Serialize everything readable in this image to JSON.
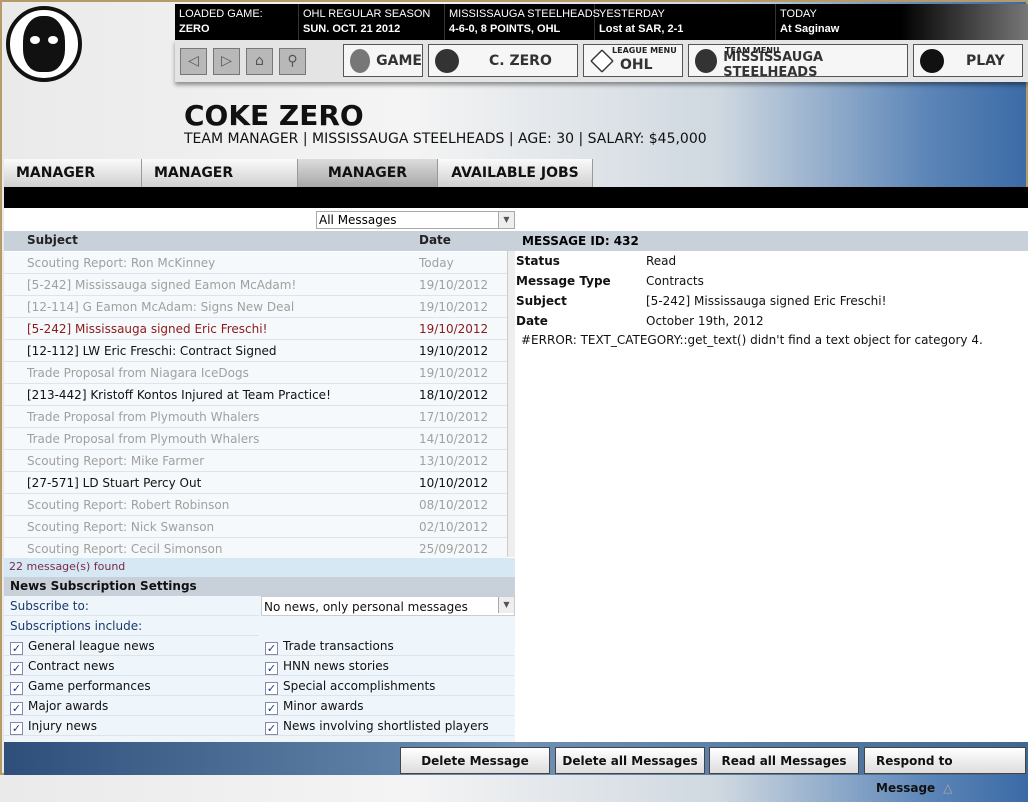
{
  "top": {
    "cells": [
      {
        "l1": "LOADED GAME:",
        "l2": "ZERO"
      },
      {
        "l1": "OHL REGULAR SEASON",
        "l2": "SUN. OCT. 21 2012"
      },
      {
        "l1": "MISSISSAUGA STEELHEADS",
        "l2": "4-6-0, 8 POINTS, OHL"
      },
      {
        "l1": "YESTERDAY",
        "l2": "Lost at SAR, 2-1"
      },
      {
        "l1": "TODAY",
        "l2": "At Saginaw"
      }
    ]
  },
  "nav": {
    "game": "GAME",
    "manager": "C. ZERO",
    "league_small": "LEAGUE MENU",
    "league": "OHL",
    "team_small": "TEAM MENU",
    "team": "MISSISSAUGA STEELHEADS",
    "play": "PLAY"
  },
  "header": {
    "name": "COKE ZERO",
    "subtitle": "TEAM MANAGER | MISSISSAUGA STEELHEADS |  AGE: 30 | SALARY: $45,000"
  },
  "tabs": [
    "MANAGER HOME",
    "MANAGER OPTIONS",
    "MANAGER NEWS",
    "AVAILABLE JOBS"
  ],
  "filter": "All Messages",
  "list": {
    "col_subject": "Subject",
    "col_date": "Date",
    "rows": [
      {
        "subject": "Scouting Report: Ron McKinney",
        "date": "Today",
        "state": "read"
      },
      {
        "subject": "[5-242] Mississauga signed Eamon McAdam!",
        "date": "19/10/2012",
        "state": "read"
      },
      {
        "subject": "[12-114] G Eamon McAdam: Signs New Deal",
        "date": "19/10/2012",
        "state": "read"
      },
      {
        "subject": "[5-242] Mississauga signed Eric Freschi!",
        "date": "19/10/2012",
        "state": "selected"
      },
      {
        "subject": "[12-112] LW Eric Freschi: Contract Signed",
        "date": "19/10/2012",
        "state": "unread"
      },
      {
        "subject": "Trade Proposal from Niagara IceDogs",
        "date": "19/10/2012",
        "state": "read"
      },
      {
        "subject": "[213-442] Kristoff Kontos Injured at Team Practice!",
        "date": "18/10/2012",
        "state": "unread"
      },
      {
        "subject": "Trade Proposal from Plymouth Whalers",
        "date": "17/10/2012",
        "state": "read"
      },
      {
        "subject": "Trade Proposal from Plymouth Whalers",
        "date": "14/10/2012",
        "state": "read"
      },
      {
        "subject": "Scouting Report: Mike Farmer",
        "date": "13/10/2012",
        "state": "read"
      },
      {
        "subject": "[27-571] LD Stuart Percy Out",
        "date": "10/10/2012",
        "state": "unread"
      },
      {
        "subject": "Scouting Report: Robert Robinson",
        "date": "08/10/2012",
        "state": "read"
      },
      {
        "subject": "Scouting Report: Nick Swanson",
        "date": "02/10/2012",
        "state": "read"
      },
      {
        "subject": "Scouting Report: Cecil Simonson",
        "date": "25/09/2012",
        "state": "read"
      }
    ],
    "found": "22 message(s) found"
  },
  "subs": {
    "title": "News Subscription Settings",
    "subscribe_label": "Subscribe to:",
    "subscribe_value": "No news, only personal messages",
    "include_label": "Subscriptions include:",
    "left": [
      "General league news",
      "Contract news",
      "Game performances",
      "Major awards",
      "Injury news"
    ],
    "right": [
      "Trade  transactions",
      "HNN news stories",
      "Special accomplishments",
      "Minor awards",
      "News involving shortlisted players"
    ]
  },
  "detail": {
    "id_label": "MESSAGE ID:  432",
    "rows": [
      {
        "k": "Status",
        "v": "Read"
      },
      {
        "k": "Message Type",
        "v": "Contracts"
      },
      {
        "k": "Subject",
        "v": "[5-242] Mississauga signed Eric Freschi!"
      },
      {
        "k": "Date",
        "v": "October 19th, 2012"
      }
    ],
    "body": "#ERROR: TEXT_CATEGORY::get_text() didn't find a text object for category 4."
  },
  "buttons": [
    "Delete Message",
    "Delete all Messages",
    "Read all Messages",
    "Respond to Message"
  ],
  "colors": {
    "read": "#a0a0a0",
    "unread": "#111111",
    "selected": "#8b1a1a"
  }
}
